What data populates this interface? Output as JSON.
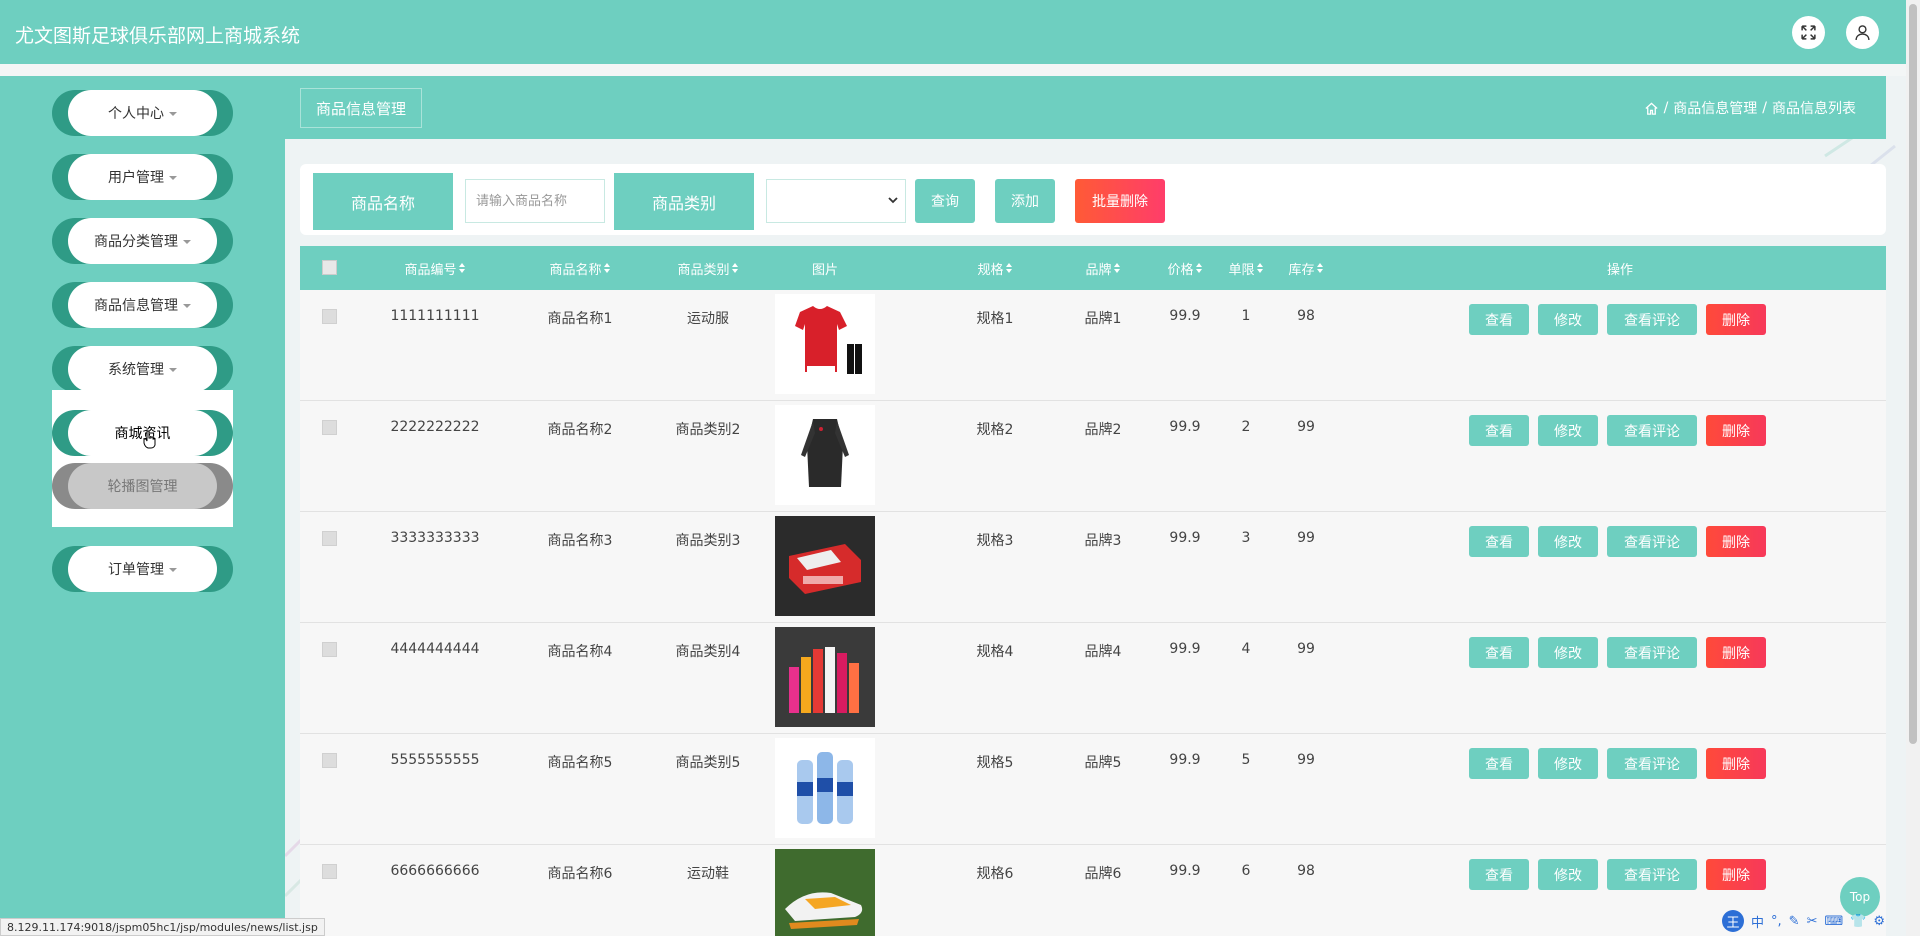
{
  "header": {
    "title": "尤文图斯足球俱乐部网上商城系统"
  },
  "sidebar": {
    "items": [
      {
        "label": "个人中心"
      },
      {
        "label": "用户管理"
      },
      {
        "label": "商品分类管理"
      },
      {
        "label": "商品信息管理"
      },
      {
        "label": "系统管理"
      }
    ],
    "submenu": [
      {
        "label": "商城资讯",
        "active": true
      },
      {
        "label": "轮播图管理",
        "active": false
      }
    ],
    "bottom_item": {
      "label": "订单管理"
    }
  },
  "breadcrumb": {
    "tab_title": "商品信息管理",
    "path": [
      "商品信息管理",
      "商品信息列表"
    ],
    "separator": "/"
  },
  "search": {
    "name_label": "商品名称",
    "name_placeholder": "请输入商品名称",
    "category_label": "商品类别",
    "category_value": "",
    "query_button": "查询",
    "add_button": "添加",
    "batch_delete_button": "批量删除"
  },
  "table": {
    "headers": {
      "code": "商品编号",
      "name": "商品名称",
      "category": "商品类别",
      "image": "图片",
      "spec": "规格",
      "brand": "品牌",
      "price": "价格",
      "limit": "单限",
      "stock": "库存",
      "actions": "操作"
    },
    "actions": {
      "view": "查看",
      "edit": "修改",
      "comments": "查看评论",
      "delete": "删除"
    },
    "rows": [
      {
        "code": "1111111111",
        "name": "商品名称1",
        "category": "运动服",
        "image": "red-jersey-kit",
        "spec": "规格1",
        "brand": "品牌1",
        "price": "99.9",
        "limit": "1",
        "stock": "98"
      },
      {
        "code": "2222222222",
        "name": "商品名称2",
        "category": "商品类别2",
        "image": "dark-tracksuit",
        "spec": "规格2",
        "brand": "品牌2",
        "price": "99.9",
        "limit": "2",
        "stock": "99"
      },
      {
        "code": "3333333333",
        "name": "商品名称3",
        "category": "商品类别3",
        "image": "anfield-model-box",
        "spec": "规格3",
        "brand": "品牌3",
        "price": "99.9",
        "limit": "3",
        "stock": "99"
      },
      {
        "code": "4444444444",
        "name": "商品名称4",
        "category": "商品类别4",
        "image": "sports-drink-bottles",
        "spec": "规格4",
        "brand": "品牌4",
        "price": "99.9",
        "limit": "4",
        "stock": "99"
      },
      {
        "code": "5555555555",
        "name": "商品名称5",
        "category": "商品类别5",
        "image": "water-bottles",
        "spec": "规格5",
        "brand": "品牌5",
        "price": "99.9",
        "limit": "5",
        "stock": "99"
      },
      {
        "code": "6666666666",
        "name": "商品名称6",
        "category": "运动鞋",
        "image": "football-boots",
        "spec": "规格6",
        "brand": "品牌6",
        "price": "99.9",
        "limit": "6",
        "stock": "98"
      }
    ]
  },
  "top_button": "Top",
  "status_url": "8.129.11.174:9018/jspm05hc1/jsp/modules/news/list.jsp",
  "ime": {
    "mode": "中",
    "brand": "王"
  },
  "colors": {
    "primary": "#6ecfc0",
    "dark_teal": "#2f9b86",
    "danger": "#ff4a3a"
  }
}
